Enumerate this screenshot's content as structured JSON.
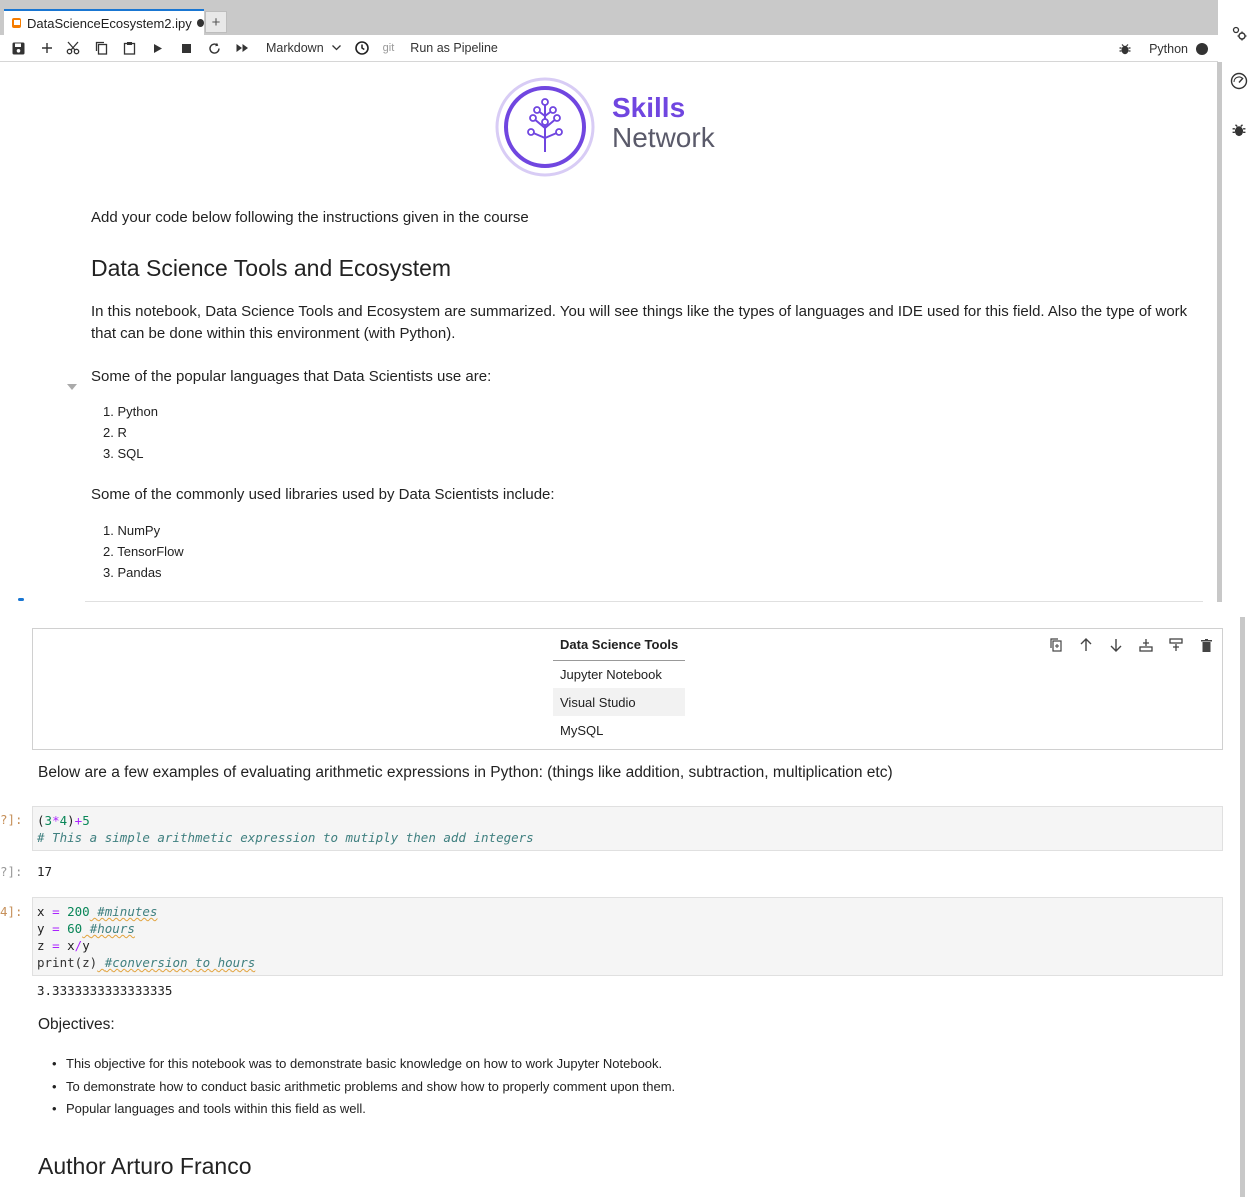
{
  "tab": {
    "title": "DataScienceEcosystem2.ipy",
    "new_tab": "+"
  },
  "toolbar": {
    "cell_type": "Markdown",
    "git_label": "git",
    "run_pipeline": "Run as Pipeline",
    "kernel": "Python"
  },
  "logo": {
    "line1": "Skills",
    "line2": "Network"
  },
  "upper": {
    "intro": "Add your code below following the instructions given in the course",
    "heading": "Data Science Tools and Ecosystem",
    "summary": "In this notebook, Data Science Tools and Ecosystem are summarized. You will see things like the types of languages and IDE used for this field. Also the type of work that can be done within this environment (with Python).",
    "languages_intro": "Some of the popular languages that Data Scientists use are:",
    "languages": [
      "1. Python",
      "2. R",
      "3. SQL"
    ],
    "libraries_intro": "Some of the commonly used libraries used by Data Scientists include:",
    "libraries": [
      "1. NumPy",
      "2. TensorFlow",
      "3. Pandas"
    ]
  },
  "tools_table": {
    "header": "Data Science Tools",
    "rows": [
      "Jupyter Notebook",
      "Visual Studio",
      "MySQL"
    ]
  },
  "lower": {
    "arith_intro": "Below are a few examples of evaluating arithmetic expressions in Python: (things like addition, subtraction, multiplication etc)",
    "prompt1": "?]:",
    "prompt1_out": "?]:",
    "prompt2": "4]:",
    "code1_line1_parts": [
      "(",
      "3",
      "*",
      "4",
      ")",
      "+",
      "5"
    ],
    "code1_comment": "# This a simple arithmetic expression to mutiply then add integers",
    "output1": "17",
    "output2": "3.3333333333333335",
    "objectives_heading": "Objectives:",
    "objectives": [
      "This objective for this notebook was to demonstrate basic knowledge on how to work Jupyter Notebook.",
      "To demonstrate how to conduct basic arithmetic problems and show how to properly comment upon them.",
      "Popular languages and tools within this field as well."
    ],
    "author": "Author Arturo Franco"
  },
  "code2": {
    "l1_var": "x",
    "l1_eq": "=",
    "l1_num": "200",
    "l1_cm": "#minutes",
    "l2_var": "y",
    "l2_eq": "=",
    "l2_num": "60",
    "l2_cm": "#hours",
    "l3_text": "z",
    "l3_eq": "=",
    "l3_rhs1": "x",
    "l3_op": "/",
    "l3_rhs2": "y",
    "l4_fn": "print(z)",
    "l4_cm": "#conversion to hours"
  },
  "colors": {
    "accent": "#1976d2",
    "logo_purple": "#7046e0"
  }
}
